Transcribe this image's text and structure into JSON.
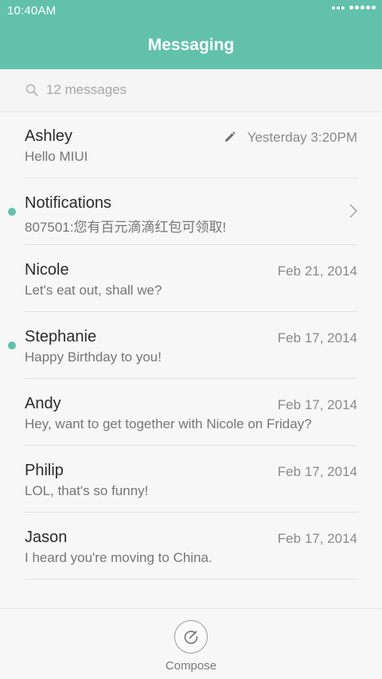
{
  "status_bar": {
    "time": "10:40AM"
  },
  "header": {
    "title": "Messaging"
  },
  "search": {
    "placeholder": "12 messages"
  },
  "conversations": [
    {
      "name": "Ashley",
      "preview": "Hello MIUI",
      "date": "Yesterday 3:20PM",
      "draft": true,
      "unread": false
    },
    {
      "name": "Notifications",
      "preview": "807501:您有百元滴滴红包可领取!",
      "date": "",
      "unread": true,
      "has_chevron": true
    },
    {
      "name": "Nicole",
      "preview": "Let's eat out, shall we?",
      "date": "Feb 21, 2014",
      "unread": false
    },
    {
      "name": "Stephanie",
      "preview": "Happy Birthday to you!",
      "date": "Feb 17, 2014",
      "unread": true
    },
    {
      "name": "Andy",
      "preview": "Hey, want to get together with Nicole on Friday?",
      "date": "Feb 17, 2014",
      "unread": false
    },
    {
      "name": "Philip",
      "preview": "LOL, that's so funny!",
      "date": "Feb 17, 2014",
      "unread": false
    },
    {
      "name": "Jason",
      "preview": "I heard you're moving to China.",
      "date": "Feb 17, 2014",
      "unread": false
    }
  ],
  "bottom_bar": {
    "compose_label": "Compose"
  },
  "colors": {
    "accent": "#62c1ab",
    "background": "#f7f7f7"
  },
  "icons": {
    "search": "search-icon",
    "draft": "pencil-icon",
    "chevron": "chevron-right-icon",
    "compose": "compose-icon"
  }
}
